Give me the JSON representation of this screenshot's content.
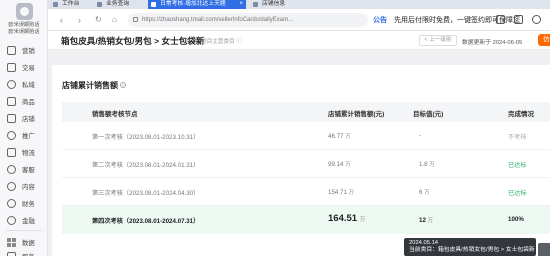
{
  "sidebar": {
    "name_lines": [
      "欧米误颠陷话",
      "欧米误颠陷话"
    ],
    "items": [
      {
        "label": "营销",
        "icon": "megaphone-icon"
      },
      {
        "label": "交易",
        "icon": "transaction-icon"
      },
      {
        "label": "私域",
        "icon": "private-domain-icon"
      },
      {
        "label": "商品",
        "icon": "goods-icon"
      },
      {
        "label": "店铺",
        "icon": "store-icon"
      },
      {
        "label": "推广",
        "icon": "promotion-icon"
      },
      {
        "label": "物流",
        "icon": "logistics-icon"
      },
      {
        "label": "客服",
        "icon": "customer-service-icon"
      },
      {
        "label": "内容",
        "icon": "content-icon"
      },
      {
        "label": "财务",
        "icon": "finance-icon"
      },
      {
        "label": "金融",
        "icon": "loan-icon"
      },
      {
        "label": "数据",
        "icon": "data-icon"
      },
      {
        "label": "服务",
        "icon": "service-icon"
      }
    ]
  },
  "browser": {
    "tabs": [
      "工作台",
      "业务查询",
      "日常考核-增加北达上天题",
      "店铺信息"
    ],
    "url": "https://zhaoshang.tmall.com/sellerInfoCards/dailyExam..."
  },
  "notice": {
    "tag": "公告",
    "text": "先用后付限时免费，一键签约即可保障您"
  },
  "page": {
    "title": "箱包皮具/热销女包/男包 > 女士包袋新",
    "subtitle": "类目主营类目 ⓘ",
    "prev_label": "< 上一级别",
    "data_update": "数据更新于 2024-06-05",
    "action_label": "仿"
  },
  "card": {
    "title": "店铺累计销售额",
    "columns": [
      "销售额考核节点",
      "店铺累计销售额(元)",
      "目标值(元)",
      "完成情况"
    ],
    "rows": [
      {
        "node": "第一次考核（2023.08.01-2023.10.31）",
        "sales": "46.77",
        "sales_unit": "万",
        "target": "-",
        "target_unit": "",
        "status": "不考核",
        "status_type": "gray"
      },
      {
        "node": "第二次考核（2023.08.01-2024.01.31）",
        "sales": "99.14",
        "sales_unit": "万",
        "target": "1.8",
        "target_unit": "万",
        "status": "已达标",
        "status_type": "green"
      },
      {
        "node": "第三次考核（2023.08.01-2024.04.30）",
        "sales": "154.71",
        "sales_unit": "万",
        "target": "6",
        "target_unit": "万",
        "status": "已达标",
        "status_type": "green"
      },
      {
        "node": "第四次考核（2023.08.01-2024.07.31）",
        "sales": "164.51",
        "sales_unit": "万",
        "target": "12",
        "target_unit": "万",
        "status": "100%",
        "status_type": "bold"
      }
    ]
  },
  "tooltip": {
    "line1": "2024.05.14",
    "line2": "当前类目：箱包皮具/热销女包/男包 > 女士包袋新"
  }
}
